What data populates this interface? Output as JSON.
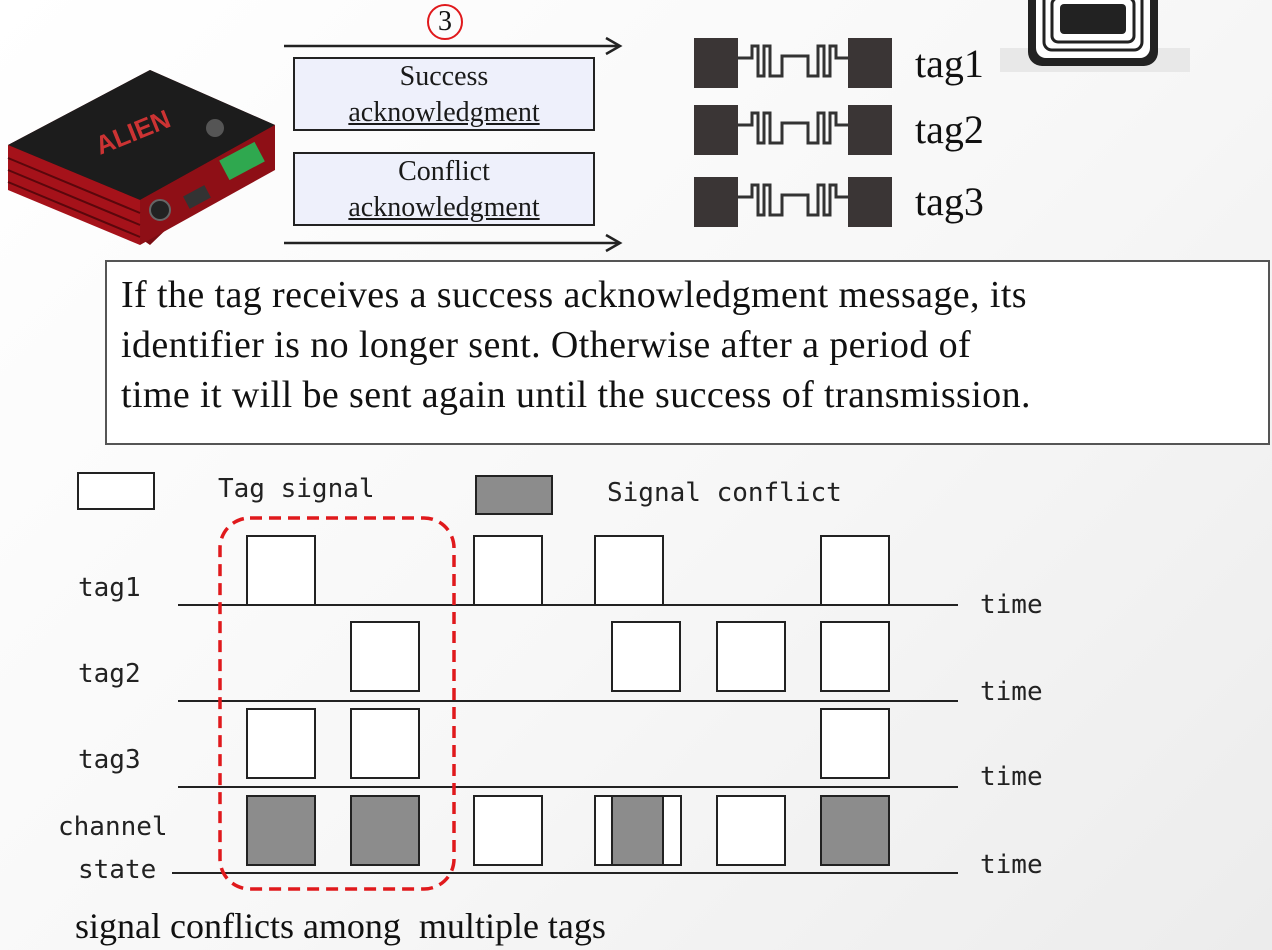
{
  "step": {
    "number": "3"
  },
  "acks": {
    "success": {
      "line1": "Success",
      "line2": "acknowledgment"
    },
    "conflict": {
      "line1": "Conflict",
      "line2": "acknowledgment"
    }
  },
  "tags": [
    "tag1",
    "tag2",
    "tag3"
  ],
  "info_text": {
    "line1": "If the tag receives a success acknowledgment message, its",
    "line2": "identifier is no longer sent. Otherwise after a period of",
    "line3": "time it will be sent again until the success of transmission."
  },
  "legend": {
    "tag_signal": "Tag signal",
    "signal_conflict": "Signal conflict"
  },
  "timing": {
    "rows": [
      {
        "label": "tag1",
        "axis": "time"
      },
      {
        "label": "tag2",
        "axis": "time"
      },
      {
        "label": "tag3",
        "axis": "time"
      },
      {
        "label_line1": "channel",
        "label_line2": "state",
        "axis": "time"
      }
    ]
  },
  "caption": "signal conflicts among  multiple tags",
  "colors": {
    "conflict_fill": "#8c8c8c",
    "highlight": "#e0191c",
    "ack_fill": "#eef0fb",
    "reader_red": "#b3141c"
  }
}
